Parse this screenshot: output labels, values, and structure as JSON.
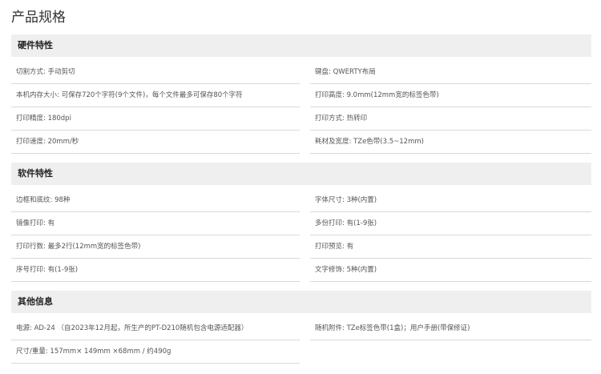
{
  "page_title": "产品规格",
  "sections": [
    {
      "title": "硬件特性",
      "rows": [
        [
          "切割方式: 手动剪切",
          "键盘: QWERTY布局"
        ],
        [
          "本机内存大小: 可保存720个字符(9个文件)，每个文件最多可保存80个字符",
          "打印高度: 9.0mm(12mm宽的标签色带)"
        ],
        [
          "打印精度: 180dpi",
          "打印方式: 热转印"
        ],
        [
          "打印速度: 20mm/秒",
          "耗材及宽度: TZe色带(3.5~12mm)"
        ]
      ]
    },
    {
      "title": "软件特性",
      "rows": [
        [
          "边框和底纹: 98种",
          "字体尺寸: 3种(内置)"
        ],
        [
          "镜像打印: 有",
          "多份打印: 有(1-9张)"
        ],
        [
          "打印行数: 最多2行(12mm宽的标签色带)",
          "打印预览: 有"
        ],
        [
          "序号打印: 有(1-9张)",
          "文字修饰: 5种(内置)"
        ]
      ]
    },
    {
      "title": "其他信息",
      "rows": [
        [
          "电源: AD-24 （自2023年12月起，所生产的PT-D210随机包含电源适配器）",
          "随机附件: TZe标签色带(1盒)；用户手册(带保修证)"
        ],
        [
          "尺寸/重量: 157mm× 149mm ×68mm / 约490g",
          ""
        ]
      ]
    }
  ]
}
